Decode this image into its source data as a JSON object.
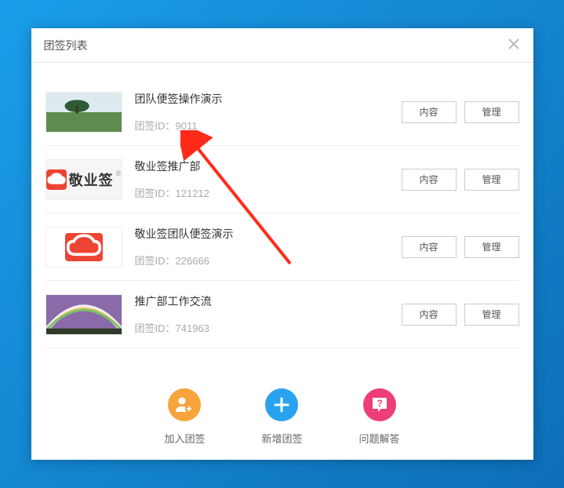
{
  "dialog": {
    "title": "团签列表"
  },
  "list": [
    {
      "title": "团队便签操作演示",
      "meta": "团签ID：9011"
    },
    {
      "title": "敬业签推广部",
      "meta": "团签ID：121212"
    },
    {
      "title": "敬业签团队便签演示",
      "meta": "团签ID：226666"
    },
    {
      "title": "推广部工作交流",
      "meta": "团签ID：741963"
    }
  ],
  "actions": {
    "content": "内容",
    "manage": "管理"
  },
  "footer": {
    "join": "加入团签",
    "create": "新增团签",
    "help": "问题解答"
  },
  "logo": {
    "text": "敬业签"
  }
}
